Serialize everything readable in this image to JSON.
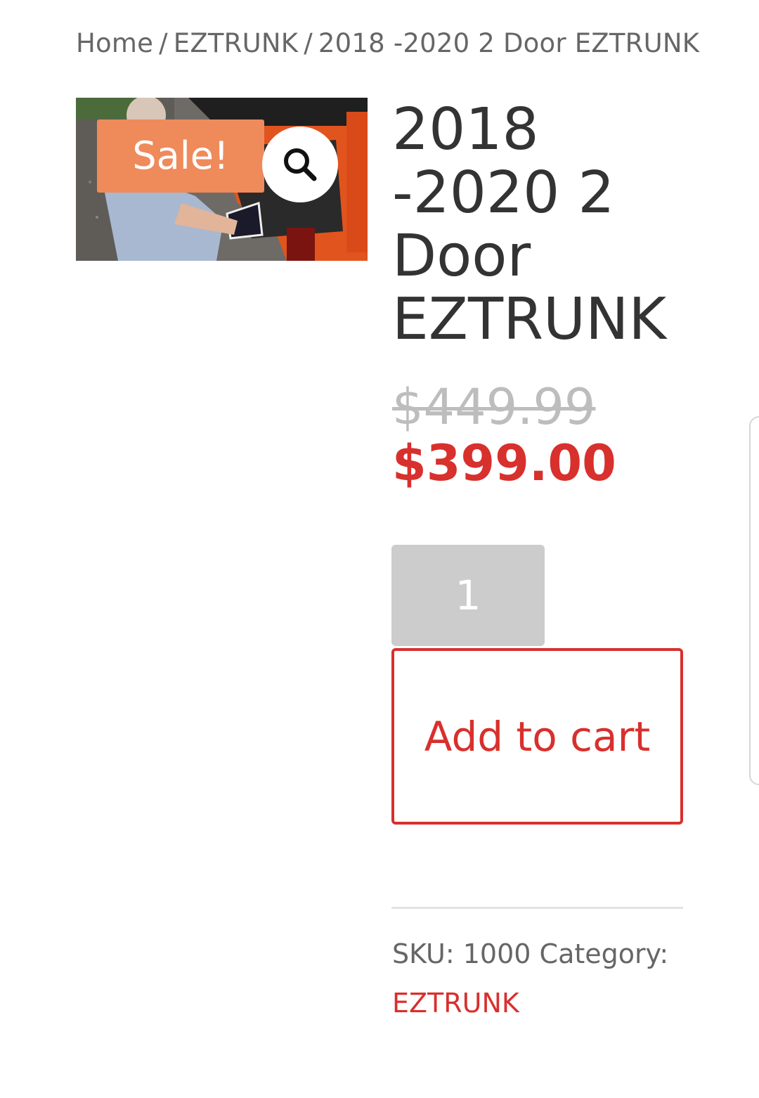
{
  "breadcrumb": {
    "home": "Home",
    "separator": "/",
    "category": "EZTRUNK",
    "current": "2018 -2020 2 Door EZTRUNK"
  },
  "product": {
    "title": "2018 -2020 2 Door EZTRUNK",
    "sale_badge": "Sale!",
    "zoom_icon": "search-icon",
    "image_description_icon": "product-photo",
    "price_regular": "$449.99",
    "price_sale": "$399.00",
    "quantity": "1",
    "add_to_cart_label": "Add to cart",
    "sku_label": "SKU:",
    "sku_value": "1000",
    "category_label": "Category:",
    "category_value": "EZTRUNK"
  },
  "colors": {
    "accent": "#d8302d",
    "sale_badge": "#ef8a5b",
    "text": "#333333",
    "muted": "#666666",
    "old_price": "#bdbdbd",
    "quantity_bg": "#cccccc"
  }
}
